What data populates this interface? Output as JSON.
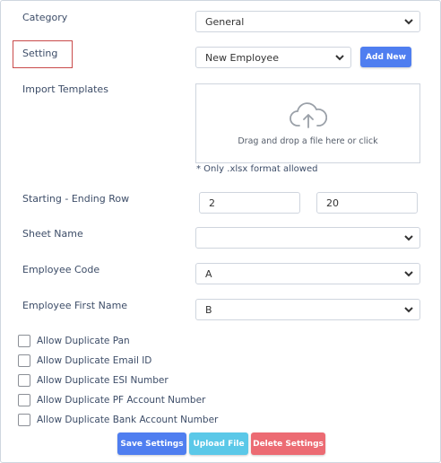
{
  "category": {
    "label": "Category",
    "value": "General"
  },
  "setting": {
    "label": "Setting",
    "value": "New Employee",
    "add_new": "Add New"
  },
  "import_templates": {
    "label": "Import Templates",
    "dropzone_text": "Drag and drop a file here or click",
    "note": "* Only .xlsx format allowed"
  },
  "rows": {
    "label": "Starting - Ending Row",
    "start": "2",
    "end": "20"
  },
  "sheet_name": {
    "label": "Sheet Name",
    "value": ""
  },
  "employee_code": {
    "label": "Employee Code",
    "value": "A"
  },
  "employee_first_name": {
    "label": "Employee First Name",
    "value": "B"
  },
  "checkboxes": [
    {
      "label": "Allow Duplicate Pan"
    },
    {
      "label": "Allow Duplicate Email ID"
    },
    {
      "label": "Allow Duplicate ESI Number"
    },
    {
      "label": "Allow Duplicate PF Account Number"
    },
    {
      "label": "Allow Duplicate Bank Account Number"
    }
  ],
  "actions": {
    "save": "Save Settings",
    "upload": "Upload File",
    "delete": "Delete Settings"
  },
  "colors": {
    "primary": "#4f7ef0",
    "info": "#5bc8e8",
    "danger": "#ec6b73",
    "highlight": "#c94a4a"
  },
  "icons": {
    "chevron": "chevron-down-icon",
    "upload": "cloud-upload-icon",
    "checkbox": "checkbox-icon"
  }
}
